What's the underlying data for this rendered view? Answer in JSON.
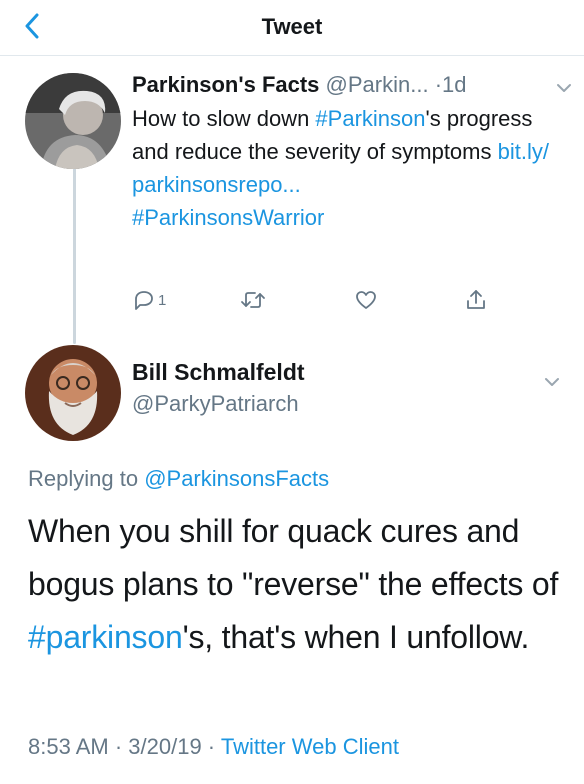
{
  "nav": {
    "title": "Tweet"
  },
  "parent_tweet": {
    "display_name": "Parkinson's Facts",
    "handle": "@Parkin...",
    "time": "·1d",
    "text_1": "How to slow down ",
    "hashtag_1": "#Parkinson",
    "text_2": "'s progress and reduce the severity of symptoms ",
    "link_1": "bit.ly/",
    "link_2": "parkinsonsrepo...",
    "hashtag_2": "#ParkinsonsWarrior",
    "reply_count": "1"
  },
  "main_tweet": {
    "display_name": "Bill Schmalfeldt",
    "handle": "@ParkyPatriarch",
    "replying_label": "Replying to ",
    "replying_handle": "@ParkinsonsFacts",
    "text_1": "When you shill for quack cures and bogus plans to \"reverse\" the effects of ",
    "hashtag": "#parkinson",
    "text_2": "'s, that's when I unfollow.",
    "time": "8:53 AM",
    "date": "3/20/19",
    "source": "Twitter Web Client",
    "separator": " · "
  },
  "icons": {
    "back": "chevron-left-icon",
    "more": "chevron-down-icon",
    "reply": "reply-icon",
    "retweet": "retweet-icon",
    "like": "heart-icon",
    "share": "share-icon"
  },
  "colors": {
    "link": "#1b95e0",
    "secondary": "#657786",
    "text": "#14171a"
  }
}
